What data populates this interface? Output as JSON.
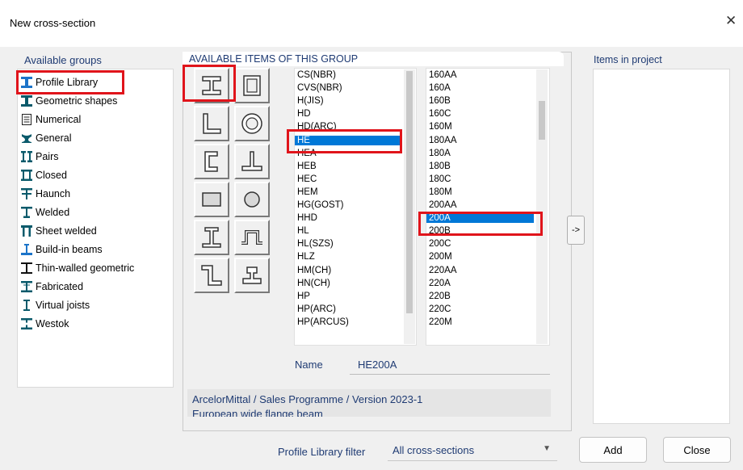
{
  "window": {
    "title": "New cross-section",
    "close_glyph": "✕"
  },
  "labels": {
    "available_groups": "Available groups",
    "available_items": "AVAILABLE ITEMS OF THIS GROUP",
    "items_in_project": "Items in project",
    "name": "Name",
    "profile_library_filter": "Profile Library filter"
  },
  "groups": [
    {
      "label": "Profile Library",
      "icon": "i-beam-icon",
      "selected": true
    },
    {
      "label": "Geometric shapes",
      "icon": "geometric-shapes-icon"
    },
    {
      "label": "Numerical",
      "icon": "document-icon"
    },
    {
      "label": "General",
      "icon": "general-section-icon"
    },
    {
      "label": "Pairs",
      "icon": "pairs-icon"
    },
    {
      "label": "Closed",
      "icon": "closed-section-icon"
    },
    {
      "label": "Haunch",
      "icon": "haunch-icon"
    },
    {
      "label": "Welded",
      "icon": "welded-icon"
    },
    {
      "label": "Sheet welded",
      "icon": "sheet-welded-icon"
    },
    {
      "label": "Build-in beams",
      "icon": "build-in-beam-icon"
    },
    {
      "label": "Thin-walled geometric",
      "icon": "thin-walled-icon"
    },
    {
      "label": "Fabricated",
      "icon": "fabricated-icon"
    },
    {
      "label": "Virtual joists",
      "icon": "virtual-joist-icon"
    },
    {
      "label": "Westok",
      "icon": "westok-icon"
    }
  ],
  "shape_buttons": [
    {
      "icon": "i-section-icon",
      "selected": true
    },
    {
      "icon": "rectangular-tube-icon"
    },
    {
      "icon": "angle-section-icon"
    },
    {
      "icon": "circular-tube-icon"
    },
    {
      "icon": "channel-section-icon"
    },
    {
      "icon": "tee-section-icon"
    },
    {
      "icon": "solid-rectangle-icon"
    },
    {
      "icon": "solid-circle-icon"
    },
    {
      "icon": "asymmetric-i-icon"
    },
    {
      "icon": "omega-section-icon"
    },
    {
      "icon": "z-section-icon"
    },
    {
      "icon": "rail-section-icon"
    }
  ],
  "series_list": [
    "CS(NBR)",
    "CVS(NBR)",
    "H(JIS)",
    "HD",
    "HD(ARC)",
    "HE",
    "HEA",
    "HEB",
    "HEC",
    "HEM",
    "HG(GOST)",
    "HHD",
    "HL",
    "HL(SZS)",
    "HLZ",
    "HM(CH)",
    "HN(CH)",
    "HP",
    "HP(ARC)",
    "HP(ARCUS)"
  ],
  "series_selected": "HE",
  "size_list": [
    "160AA",
    "160A",
    "160B",
    "160C",
    "160M",
    "180AA",
    "180A",
    "180B",
    "180C",
    "180M",
    "200AA",
    "200A",
    "200B",
    "200C",
    "200M",
    "220AA",
    "220A",
    "220B",
    "220C",
    "220M"
  ],
  "size_selected": "200A",
  "name_value": "HE200A",
  "description_lines": [
    "ArcelorMittal / Sales Programme / Version 2023-1",
    "European wide flange beam"
  ],
  "arrow_label": "->",
  "filter": {
    "value": "All cross-sections"
  },
  "buttons": {
    "add": "Add",
    "close": "Close"
  },
  "colors": {
    "selection": "#0078d7",
    "highlight": "#e0141b",
    "accent_text": "#1f3b73",
    "icon_teal": "#0a5a6b"
  }
}
